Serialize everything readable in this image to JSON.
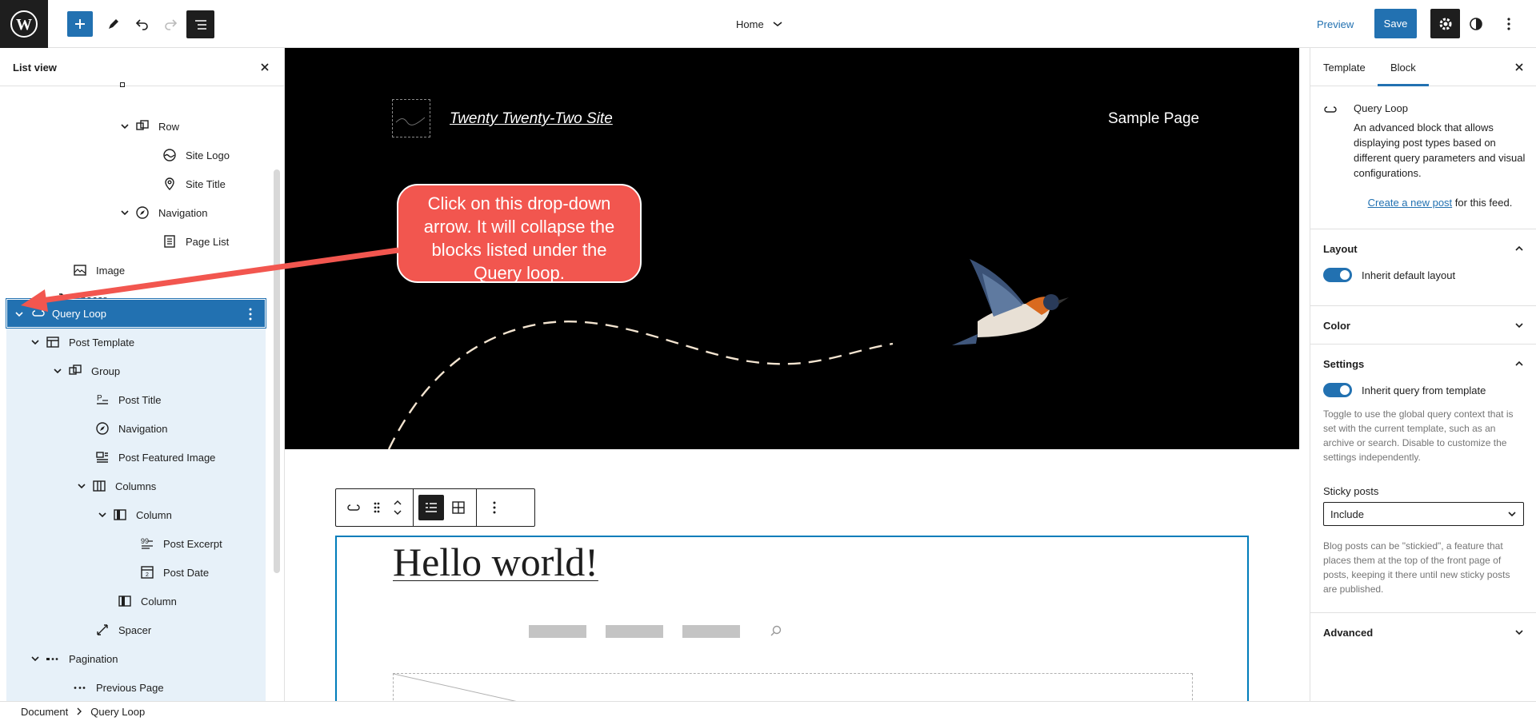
{
  "topbar": {
    "document_title": "Home",
    "preview_label": "Preview",
    "save_label": "Save"
  },
  "list_view": {
    "title": "List view",
    "items": [
      {
        "label": "Row",
        "icon": "row-icon"
      },
      {
        "label": "Site Logo",
        "icon": "site-logo-icon"
      },
      {
        "label": "Site Title",
        "icon": "map-pin-icon"
      },
      {
        "label": "Navigation",
        "icon": "compass-icon"
      },
      {
        "label": "Page List",
        "icon": "page-list-icon"
      },
      {
        "label": "Image",
        "icon": "image-icon"
      },
      {
        "label": "Spacer",
        "icon": "resize-icon"
      },
      {
        "label": "Query Loop",
        "icon": "loop-icon"
      },
      {
        "label": "Post Template",
        "icon": "layout-icon"
      },
      {
        "label": "Group",
        "icon": "group-icon"
      },
      {
        "label": "Post Title",
        "icon": "title-icon"
      },
      {
        "label": "Navigation",
        "icon": "compass-icon"
      },
      {
        "label": "Post Featured Image",
        "icon": "featured-image-icon"
      },
      {
        "label": "Columns",
        "icon": "columns-icon"
      },
      {
        "label": "Column",
        "icon": "column-icon"
      },
      {
        "label": "Post Excerpt",
        "icon": "excerpt-icon"
      },
      {
        "label": "Post Date",
        "icon": "calendar-icon"
      },
      {
        "label": "Column",
        "icon": "column-icon"
      },
      {
        "label": "Spacer",
        "icon": "resize-icon"
      },
      {
        "label": "Pagination",
        "icon": "pagination-icon"
      },
      {
        "label": "Previous Page",
        "icon": "pagination-icon"
      }
    ]
  },
  "canvas": {
    "site_title": "Twenty Twenty-Two Site",
    "sample_page": "Sample Page",
    "callout": "Click on this drop-down arrow.  It will collapse the blocks listed under the Query loop.",
    "post_title": "Hello world!"
  },
  "sidebar": {
    "tabs": [
      "Template",
      "Block"
    ],
    "block_name": "Query Loop",
    "block_description": "An advanced block that allows displaying post types based on different query parameters and visual configurations.",
    "create_link": "Create a new post",
    "create_suffix": " for this feed.",
    "layout": {
      "title": "Layout",
      "toggle_label": "Inherit default layout"
    },
    "color": {
      "title": "Color"
    },
    "settings": {
      "title": "Settings",
      "toggle_label": "Inherit query from template",
      "toggle_help": "Toggle to use the global query context that is set with the current template, such as an archive or search. Disable to customize the settings independently.",
      "sticky_label": "Sticky posts",
      "sticky_value": "Include",
      "sticky_help": "Blog posts can be \"stickied\", a feature that places them at the top of the front page of posts, keeping it there until new sticky posts are published."
    },
    "advanced": {
      "title": "Advanced"
    }
  },
  "footer": {
    "breadcrumb": [
      "Document",
      "Query Loop"
    ]
  },
  "colors": {
    "accent": "#2271b1",
    "callout": "#f2564f",
    "dark": "#1e1e1e"
  }
}
